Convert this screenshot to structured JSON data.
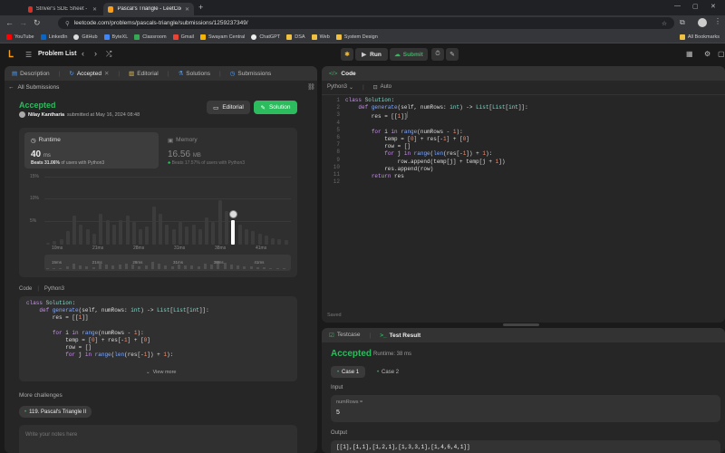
{
  "browser": {
    "tabs": [
      {
        "title": "Striver's SDE Sheet - Top Codin",
        "active": false
      },
      {
        "title": "Pascal's Triangle - LeetCode",
        "active": true
      }
    ],
    "url": "leetcode.com/problems/pascals-triangle/submissions/1259237349/",
    "bookmarks": [
      "YouTube",
      "LinkedIn",
      "GitHub",
      "ByteXL",
      "Classroom",
      "Gmail",
      "Swayam Central",
      "ChatGPT",
      "DSA",
      "Web",
      "System Design"
    ],
    "all_bookmarks": "All Bookmarks"
  },
  "header": {
    "problem_list": "Problem List",
    "run": "Run",
    "submit": "Submit"
  },
  "left": {
    "tabs": [
      "Description",
      "Accepted",
      "Editorial",
      "Solutions",
      "Submissions"
    ],
    "back": "All Submissions",
    "status": "Accepted",
    "user": "Nilay Kantharia",
    "submitted": "submitted at May 16, 2024 08:48",
    "editorial_btn": "Editorial",
    "solution_btn": "Solution",
    "runtime": {
      "label": "Runtime",
      "value": "40",
      "unit": "ms",
      "beats_label": "Beats",
      "beats": "31.06%",
      "suffix": "of users with Python3"
    },
    "memory": {
      "label": "Memory",
      "value": "16.56",
      "unit": "MB",
      "beats_label": "Beats",
      "beats": "17.57%",
      "suffix": "of users with Python3"
    },
    "y_ticks": [
      "15%",
      "10%",
      "5%",
      "0%"
    ],
    "x_ticks": [
      "10ms",
      "21ms",
      "28ms",
      "31ms",
      "38ms",
      "41ms"
    ],
    "mini_ticks": [
      "15ms",
      "21ms",
      "28ms",
      "31ms",
      "38ms",
      "41ms"
    ],
    "code_label": "Code",
    "lang": "Python3",
    "view_more": "View more",
    "more_challenges": "More challenges",
    "challenge": "119. Pascal's Triangle II",
    "notes_placeholder": "Write your notes here"
  },
  "chart_data": {
    "type": "bar",
    "ylim": [
      0,
      15
    ],
    "values": [
      0.5,
      0.8,
      1.2,
      3,
      6.5,
      4.5,
      3.5,
      2.5,
      6.8,
      5.5,
      4.5,
      5.5,
      6.5,
      5,
      3.5,
      4,
      8.5,
      6.8,
      4.5,
      3.5,
      5,
      4,
      4.5,
      3.5,
      6,
      5,
      9.8,
      7.5,
      5.5,
      4.5,
      3.5,
      3,
      2.5,
      2,
      1.5,
      1.2,
      1
    ],
    "highlight_index": 28,
    "highlight_label": "40 ms"
  },
  "editor": {
    "title": "Code",
    "lang": "Python3",
    "auto": "Auto",
    "saved": "Saved",
    "line_numbers": [
      "1",
      "2",
      "3",
      "4",
      "5",
      "6",
      "7",
      "8",
      "9",
      "10",
      "11",
      "12"
    ]
  },
  "result": {
    "tabs": [
      "Testcase",
      "Test Result"
    ],
    "status": "Accepted",
    "runtime": "Runtime: 38 ms",
    "cases": [
      "Case 1",
      "Case 2"
    ],
    "input_label": "Input",
    "param": "numRows =",
    "param_value": "5",
    "output_label": "Output",
    "output": "[[1],[1,1],[1,2,1],[1,3,3,1],[1,4,6,4,1]]"
  },
  "colors": {
    "accent_green": "#2cbb5d",
    "code_bg": "#262626"
  }
}
